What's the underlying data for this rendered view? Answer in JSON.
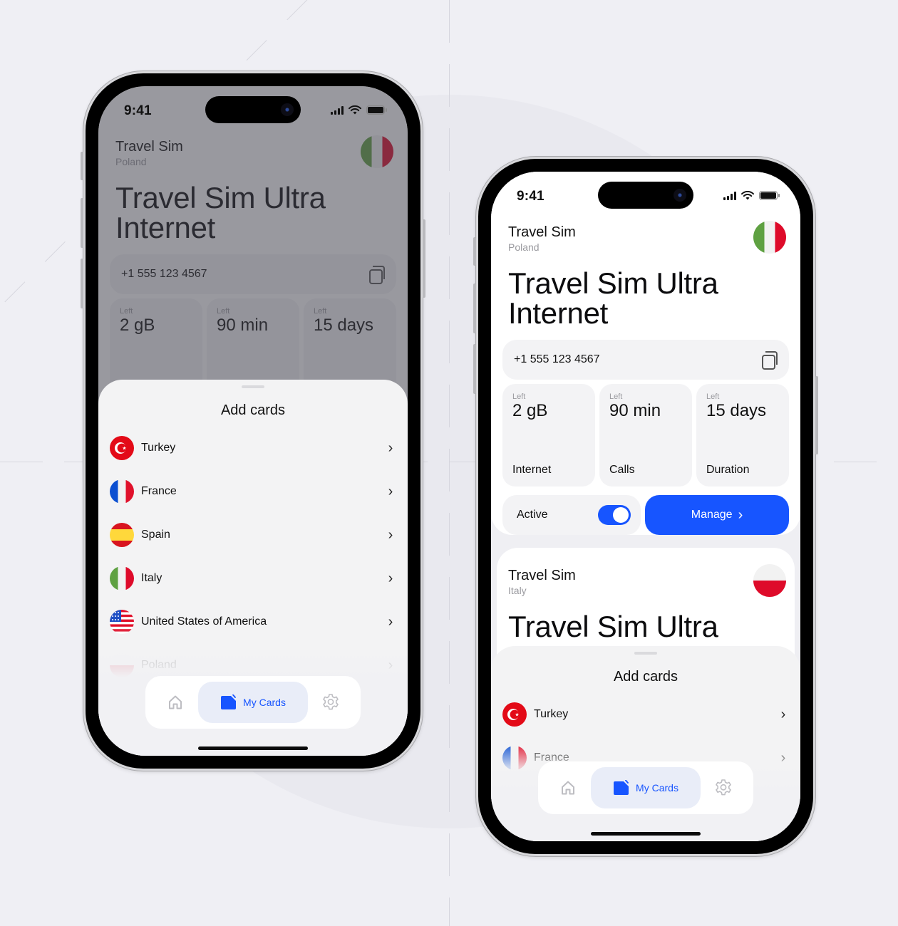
{
  "status_bar": {
    "time": "9:41"
  },
  "colors": {
    "accent": "#1755FF",
    "background": "#EFEFF4",
    "card_surface": "#F3F3F5",
    "tab_active_bg": "#E9EDF8"
  },
  "phone_left": {
    "state": "add-cards-sheet-open",
    "sim_card": {
      "name": "Travel Sim",
      "country": "Poland",
      "flag_icon": "italy-flag-icon",
      "plan_title_line1": "Travel Sim Ultra",
      "plan_title_line2": "Internet",
      "phone_number": "+1 555 123 4567",
      "stats": [
        {
          "label": "Left",
          "value": "2 gB"
        },
        {
          "label": "Left",
          "value": "90 min"
        },
        {
          "label": "Left",
          "value": "15 days"
        }
      ]
    },
    "sheet": {
      "title": "Add cards",
      "countries": [
        {
          "name": "Turkey",
          "flag_icon": "turkey-flag-icon"
        },
        {
          "name": "France",
          "flag_icon": "france-flag-icon"
        },
        {
          "name": "Spain",
          "flag_icon": "spain-flag-icon"
        },
        {
          "name": "Italy",
          "flag_icon": "italy-flag-icon"
        },
        {
          "name": "United States of America",
          "flag_icon": "usa-flag-icon"
        },
        {
          "name": "Poland",
          "flag_icon": "poland-flag-icon"
        }
      ]
    },
    "tabbar": {
      "home_icon": "home-icon",
      "active_label": "My Cards",
      "active_icon": "sim-card-icon",
      "settings_icon": "gear-icon"
    }
  },
  "phone_right": {
    "state": "cards-list",
    "cards": [
      {
        "name": "Travel Sim",
        "country": "Poland",
        "flag_icon": "italy-flag-icon",
        "plan_title_line1": "Travel Sim Ultra",
        "plan_title_line2": "Internet",
        "phone_number": "+1 555 123 4567",
        "stats": [
          {
            "label": "Left",
            "value": "2 gB",
            "kind": "Internet"
          },
          {
            "label": "Left",
            "value": "90 min",
            "kind": "Calls"
          },
          {
            "label": "Left",
            "value": "15 days",
            "kind": "Duration"
          }
        ],
        "active_label": "Active",
        "active_on": true,
        "manage_label": "Manage",
        "manage_chevron": "›"
      },
      {
        "name": "Travel Sim",
        "country": "Italy",
        "flag_icon": "poland-flag-icon",
        "plan_title_line1": "Travel Sim Ultra"
      }
    ],
    "sheet": {
      "title": "Add cards",
      "countries": [
        {
          "name": "Turkey",
          "flag_icon": "turkey-flag-icon"
        },
        {
          "name": "France",
          "flag_icon": "france-flag-icon"
        }
      ]
    },
    "tabbar": {
      "home_icon": "home-icon",
      "active_label": "My Cards",
      "active_icon": "sim-card-icon",
      "settings_icon": "gear-icon"
    }
  },
  "chevron": "›"
}
